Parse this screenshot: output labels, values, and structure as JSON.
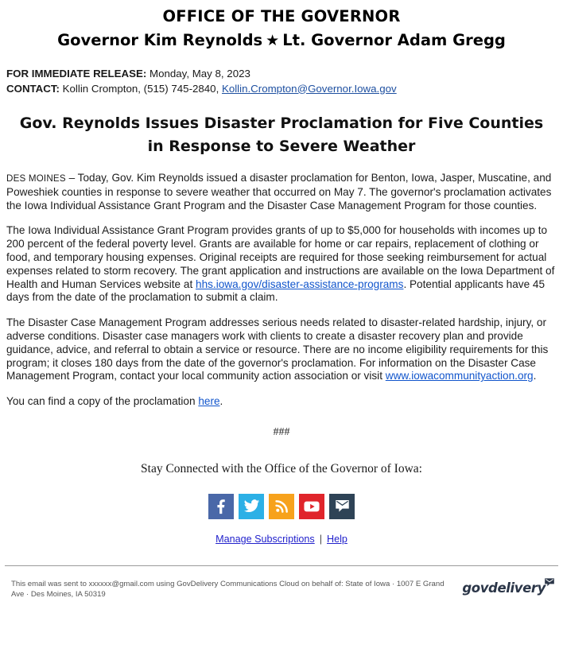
{
  "masthead": {
    "office": "OFFICE OF THE GOVERNOR",
    "governor": "Governor Kim Reynolds",
    "star": "★",
    "lt_governor": "Lt. Governor Adam Gregg"
  },
  "meta": {
    "release_label": "FOR IMMEDIATE RELEASE:",
    "release_date": " Monday, May 8, 2023",
    "contact_label": "CONTACT:",
    "contact_value": " Kollin Crompton, (515) 745-2840, ",
    "contact_email": "Kollin.Crompton@Governor.Iowa.gov"
  },
  "headline": "Gov. Reynolds Issues Disaster Proclamation for Five Counties in Response to Severe Weather",
  "body": {
    "p1_dateline": "DES MOINES",
    "p1_text": " – Today, Gov. Kim Reynolds issued a disaster proclamation for Benton, Iowa, Jasper, Muscatine, and Poweshiek counties in response to severe weather that occurred on May 7. The governor's proclamation activates the Iowa Individual Assistance Grant Program and the Disaster Case Management Program for those counties.",
    "p2_part1": "The Iowa Individual Assistance Grant Program provides grants of up to $5,000 for households with incomes up to 200 percent of the federal poverty level. Grants are available for home or car repairs, replacement of clothing or food, and temporary housing expenses. Original receipts are required for those seeking reimbursement for actual expenses related to storm recovery. The grant application and instructions are available on the Iowa Department of Health and Human Services website at ",
    "p2_link": "hhs.iowa.gov/disaster-assistance-programs",
    "p2_part2": ". Potential applicants have 45 days from the date of the proclamation to submit a claim.",
    "p3_part1": "The Disaster Case Management Program addresses serious needs related to disaster-related hardship, injury, or adverse conditions. Disaster case managers work with clients to create a disaster recovery plan and provide guidance, advice, and referral to obtain a service or resource. There are no income eligibility requirements for this program; it closes 180 days from the date of the governor's proclamation. For information on the Disaster Case Management Program, contact your local community action association or visit ",
    "p3_link": "www.iowacommunityaction.org",
    "p3_part2": ".",
    "p4_part1": "You can find a copy of the proclamation ",
    "p4_link": "here",
    "p4_part2": "."
  },
  "separator": "###",
  "footer": {
    "stay_connected": "Stay Connected with the Office of the Governor of Iowa:",
    "social": [
      {
        "name": "facebook",
        "label": "Facebook",
        "color": "#4a68a8"
      },
      {
        "name": "twitter",
        "label": "Twitter",
        "color": "#2cb0e6"
      },
      {
        "name": "rss",
        "label": "RSS",
        "color": "#f7a21c"
      },
      {
        "name": "youtube",
        "label": "YouTube",
        "color": "#e0252b"
      },
      {
        "name": "email",
        "label": "Email",
        "color": "#2e4356"
      }
    ],
    "manage_subscriptions": "Manage Subscriptions",
    "separator": "|",
    "help": "Help",
    "legal": "This email was sent to xxxxxx@gmail.com using GovDelivery Communications Cloud on behalf of: State of Iowa · 1007 E Grand Ave · Des Moines, IA 50319",
    "logo_text": "govdelivery"
  }
}
